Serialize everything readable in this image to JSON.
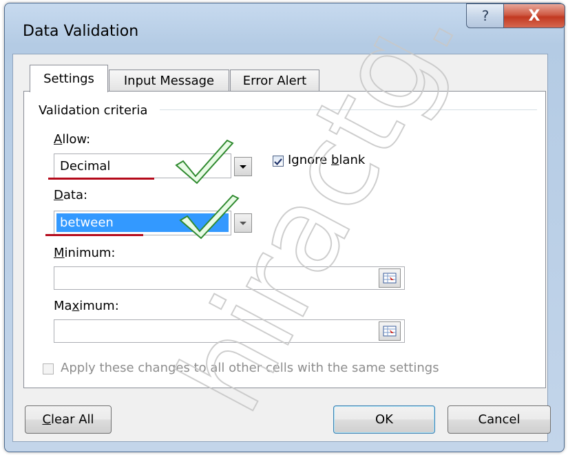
{
  "window": {
    "title": "Data Validation",
    "help_glyph": "?",
    "close_glyph": "X"
  },
  "tabs": [
    {
      "label": "Settings",
      "active": true
    },
    {
      "label": "Input Message",
      "active": false
    },
    {
      "label": "Error Alert",
      "active": false
    }
  ],
  "settings": {
    "group_label": "Validation criteria",
    "allow": {
      "label_mnemonic": "A",
      "label_rest": "llow:",
      "value": "Decimal"
    },
    "ignore_blank": {
      "label_pre": "Ignore ",
      "label_mnemonic": "b",
      "label_post": "lank",
      "checked": true
    },
    "data": {
      "label_mnemonic": "D",
      "label_rest": "ata:",
      "value": "between",
      "selected": true
    },
    "minimum": {
      "label_mnemonic": "M",
      "label_rest": "inimum:",
      "value": ""
    },
    "maximum": {
      "label_pre": "Ma",
      "label_mnemonic": "x",
      "label_post": "imum:",
      "value": ""
    },
    "apply_all": {
      "label": "Apply these changes to all other cells with the same settings",
      "checked": false,
      "enabled": false
    }
  },
  "buttons": {
    "clear_all": {
      "mnemonic": "C",
      "rest": "lear All"
    },
    "ok": "OK",
    "cancel": "Cancel"
  },
  "watermark": "hiractg.blog",
  "colors": {
    "selection": "#3399ff",
    "annotation_red": "#b4091a",
    "title_bar": "#b9cfe7"
  }
}
